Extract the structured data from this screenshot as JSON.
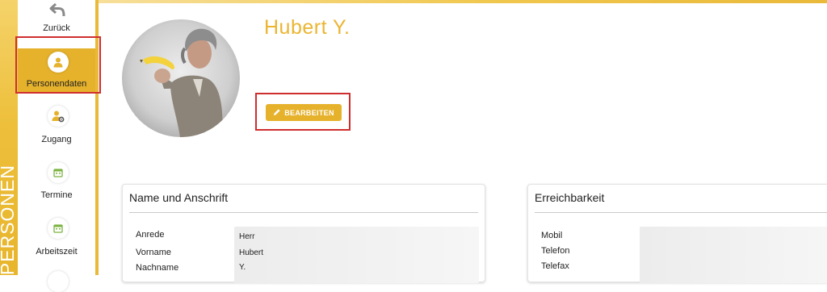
{
  "section": {
    "vertical_label": "PERSONEN"
  },
  "sidebar": {
    "items": [
      {
        "label": "Zurück",
        "icon": "back-arrow-icon"
      },
      {
        "label": "Personendaten",
        "icon": "person-icon",
        "active": true
      },
      {
        "label": "Zugang",
        "icon": "user-gear-icon"
      },
      {
        "label": "Termine",
        "icon": "calendar-icon"
      },
      {
        "label": "Arbeitszeit",
        "icon": "calendar-icon"
      }
    ]
  },
  "profile": {
    "name": "Hubert Y.",
    "edit_label": "BEARBEITEN",
    "edit_icon": "pencil-icon"
  },
  "cards": {
    "address": {
      "title": "Name und Anschrift",
      "fields": [
        {
          "label": "Anrede",
          "value": "Herr"
        },
        {
          "label": "Vorname",
          "value": "Hubert"
        },
        {
          "label": "Nachname",
          "value": "Y."
        }
      ]
    },
    "contact": {
      "title": "Erreichbarkeit",
      "fields": [
        {
          "label": "Mobil",
          "value": ""
        },
        {
          "label": "Telefon",
          "value": ""
        },
        {
          "label": "Telefax",
          "value": ""
        }
      ]
    }
  },
  "colors": {
    "accent": "#e6b22c",
    "name": "#ebb532",
    "highlight": "#cf2e2e"
  }
}
